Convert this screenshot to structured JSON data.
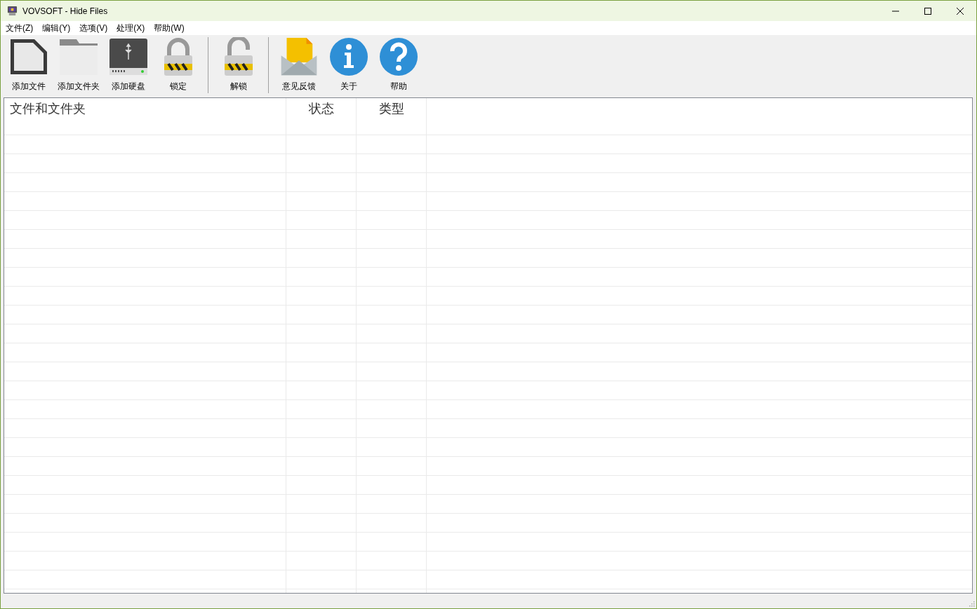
{
  "window": {
    "title": "VOVSOFT - Hide Files"
  },
  "menu": [
    "文件(Z)",
    "编辑(Y)",
    "选项(V)",
    "处理(X)",
    "帮助(W)"
  ],
  "toolbar": {
    "groups": [
      {
        "buttons": [
          "添加文件",
          "添加文件夹",
          "添加硬盘",
          "锁定"
        ]
      },
      {
        "buttons": [
          "解锁"
        ]
      },
      {
        "buttons": [
          "意见反馈",
          "关于",
          "帮助"
        ]
      }
    ]
  },
  "table": {
    "columns": [
      "文件和文件夹",
      "状态",
      "类型"
    ]
  }
}
